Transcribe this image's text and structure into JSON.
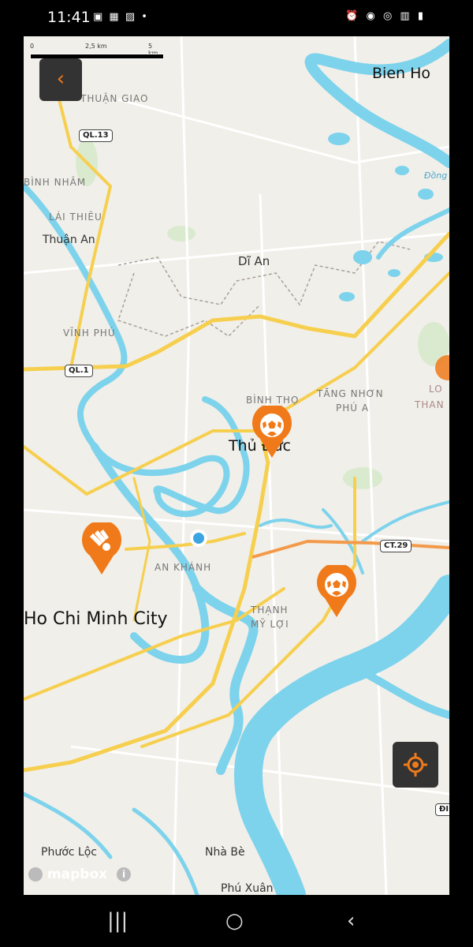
{
  "status_bar": {
    "time": "11:41",
    "left_icons": "▣ ▦ ▨ •",
    "right_icons": "⏰ ◉ ◎ ▥ ▮"
  },
  "scale": {
    "t0": "0",
    "t1": "2,5 km",
    "t2": "5 km"
  },
  "back_icon": "‹",
  "map_labels": {
    "bien_hoa": "Bien Ho",
    "thuan_giao": "THUẬN GIAO",
    "binh_nham": "BÌNH NHÂM",
    "lai_thieu": "LÁI THIÊU",
    "thuan_an": "Thuận An",
    "di_an": "Dĩ An",
    "vinh_phu": "VĨNH PHÚ",
    "binh_tho": "BÌNH THỌ",
    "tang_nhon": "TĂNG NHƠN",
    "phu_a": "PHÚ A",
    "thu_duc": "Thủ Đức",
    "an_khanh": "AN KHÁNH",
    "hcmc": "Ho Chi Minh City",
    "thanh_my_loi": "THẠNH",
    "thanh_my_loi2": "MỸ LỢI",
    "phuoc_loc": "Phước Lộc",
    "nha_be": "Nhà Bè",
    "phu_xuan": "Phú Xuân",
    "long_thanh": "LO",
    "long_thanh2": "THAN",
    "dong_nai": "Đồng"
  },
  "road_shields": {
    "ql13": "QL.13",
    "ql1": "QL.1",
    "ct29": "CT.29",
    "edge": "ĐI"
  },
  "markers": [
    {
      "name": "football-marker",
      "sport": "football"
    },
    {
      "name": "badminton-marker",
      "sport": "badminton"
    },
    {
      "name": "football-marker",
      "sport": "football"
    }
  ],
  "attribution": {
    "brand": "mapbox",
    "info": "i"
  },
  "nav": {
    "recents": "|||",
    "home": "○",
    "back": "‹"
  },
  "colors": {
    "accent": "#f07a1a",
    "water": "#7dd3ec",
    "road": "#f6cf4f",
    "user_dot": "#3aa5e0"
  }
}
